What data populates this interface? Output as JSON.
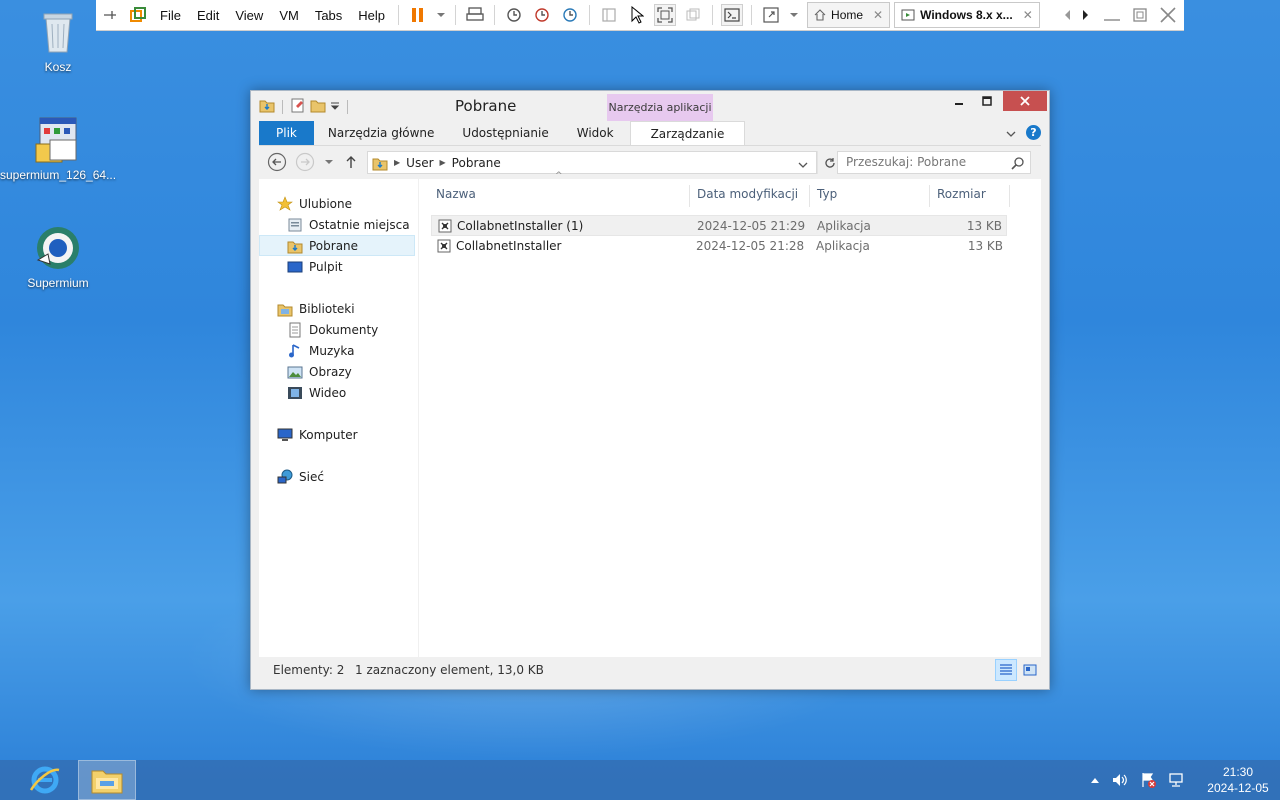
{
  "vm_toolbar": {
    "menu": [
      "File",
      "Edit",
      "View",
      "VM",
      "Tabs",
      "Help"
    ],
    "tabs": [
      {
        "label": "Home",
        "icon": "home-icon"
      },
      {
        "label": "Windows 8.x x...",
        "icon": "vm-icon"
      }
    ]
  },
  "desktop": {
    "icons": [
      {
        "label": "Kosz",
        "icon": "recycle-bin-icon"
      },
      {
        "label": "supermium_126_64...",
        "icon": "installer-icon"
      },
      {
        "label": "Supermium",
        "icon": "supermium-browser-icon"
      }
    ]
  },
  "explorer": {
    "title": "Pobrane",
    "context_group": "Narzędzia aplikacji",
    "ribbon_tabs": [
      "Plik",
      "Narzędzia główne",
      "Udostępnianie",
      "Widok",
      "Zarządzanie"
    ],
    "address": {
      "crumbs": [
        "User",
        "Pobrane"
      ]
    },
    "search_placeholder": "Przeszukaj: Pobrane",
    "nav": {
      "favorites": {
        "label": "Ulubione",
        "items": [
          "Ostatnie miejsca",
          "Pobrane",
          "Pulpit"
        ],
        "selected": "Pobrane"
      },
      "libraries": {
        "label": "Biblioteki",
        "items": [
          "Dokumenty",
          "Muzyka",
          "Obrazy",
          "Wideo"
        ]
      },
      "computer": "Komputer",
      "network": "Sieć"
    },
    "columns": [
      "Nazwa",
      "Data modyfikacji",
      "Typ",
      "Rozmiar"
    ],
    "files": [
      {
        "name": "CollabnetInstaller (1)",
        "date": "2024-12-05 21:29",
        "type": "Aplikacja",
        "size": "13 KB",
        "selected": true
      },
      {
        "name": "CollabnetInstaller",
        "date": "2024-12-05 21:28",
        "type": "Aplikacja",
        "size": "13 KB",
        "selected": false
      }
    ],
    "status": {
      "count": "Elementy: 2",
      "selection": "1 zaznaczony element, 13,0 KB"
    }
  },
  "taskbar": {
    "clock_time": "21:30",
    "clock_date": "2024-12-05"
  },
  "colors": {
    "accent": "#1979ca",
    "context_tab": "#e7c9ef",
    "close_button": "#c75050",
    "desktop": "#2f86dc"
  }
}
